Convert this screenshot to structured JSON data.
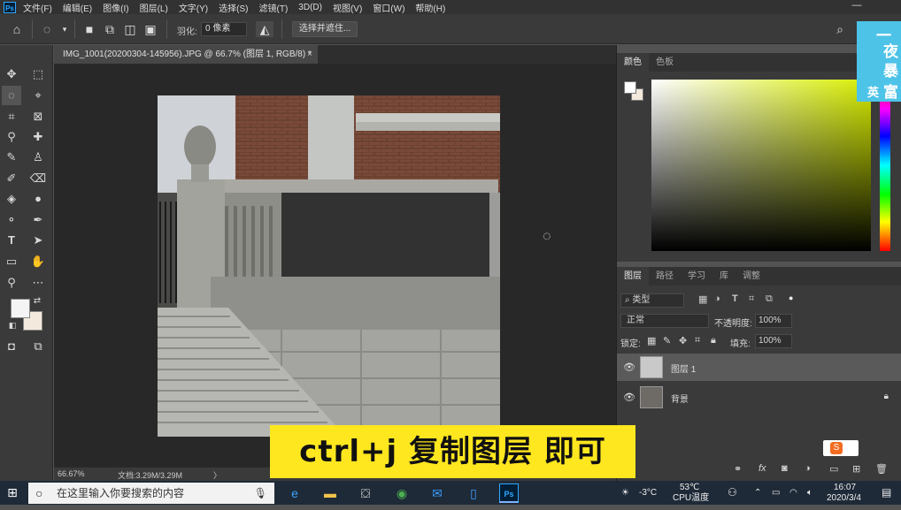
{
  "menu": {
    "logo": "Ps",
    "items": [
      "文件(F)",
      "编辑(E)",
      "图像(I)",
      "图层(L)",
      "文字(Y)",
      "选择(S)",
      "滤镜(T)",
      "3D(D)",
      "视图(V)",
      "窗口(W)",
      "帮助(H)"
    ],
    "minimize": "—"
  },
  "options": {
    "feather_label": "羽化:",
    "feather_value": "0 像素",
    "select_mask_label": "选择并遮住..."
  },
  "document": {
    "tab_title": "IMG_1001(20200304-145956).JPG @ 66.7% (图层 1, RGB/8) *",
    "close": "×"
  },
  "status": {
    "zoom": "66.67%",
    "doc_size": "文档:3.29M/3.29M",
    "arrow": "〉"
  },
  "color_panel": {
    "tabs": [
      "颜色",
      "色板"
    ],
    "foreground": "#ffffff",
    "background": "#f3e9dc"
  },
  "layers_panel": {
    "tabs": [
      "图层",
      "路径",
      "学习",
      "库",
      "调整"
    ],
    "filter_kind": "类型",
    "blend_mode": "正常",
    "opacity_label": "不透明度:",
    "opacity_value": "100%",
    "lock_label": "锁定:",
    "fill_label": "填充:",
    "fill_value": "100%",
    "layers": [
      {
        "name": "图层 1",
        "selected": true,
        "locked": false
      },
      {
        "name": "背景",
        "selected": false,
        "locked": true
      }
    ]
  },
  "banner": {
    "text": "ctrl+j 复制图层 即可"
  },
  "ime_widget": {
    "chars": [
      "一",
      "夜",
      "暴",
      "富"
    ],
    "mode": "英"
  },
  "taskbar": {
    "search_placeholder": "在这里输入你要搜索的内容",
    "weather": "-3°C",
    "cpu_temp": "53℃",
    "cpu_label": "CPU温度",
    "time": "16:07",
    "date": "2020/3/4"
  }
}
